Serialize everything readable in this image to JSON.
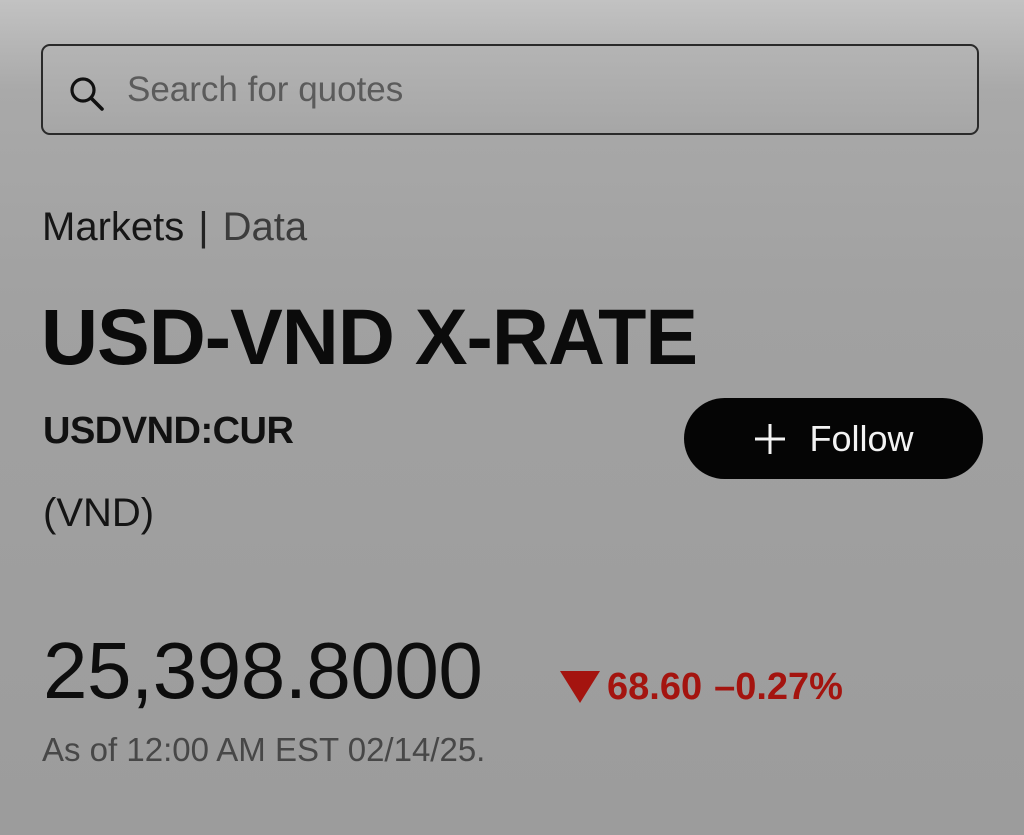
{
  "search": {
    "placeholder": "Search for quotes",
    "icon": "search-icon"
  },
  "breadcrumb": {
    "items": [
      "Markets",
      "Data"
    ],
    "separator": "|"
  },
  "quote": {
    "name": "USD-VND X-RATE",
    "ticker": "USDVND:CUR",
    "currency": "(VND)",
    "price": "25,398.8000",
    "change": "68.60",
    "change_percent": "–0.27%",
    "direction": "down",
    "timestamp": "As of 12:00 AM EST 02/14/25."
  },
  "follow_button": {
    "label": "Follow",
    "icon": "plus-icon"
  },
  "colors": {
    "negative": "#a4140f",
    "button_bg": "#050505",
    "button_text": "#f3f3f3"
  }
}
